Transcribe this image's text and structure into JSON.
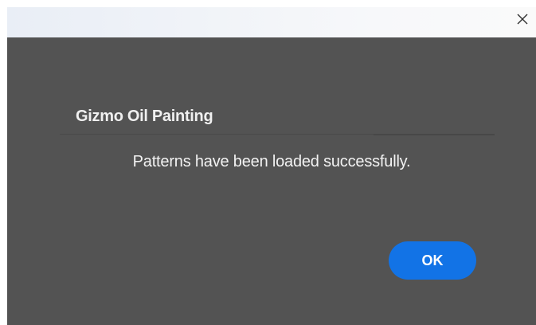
{
  "titlebar": {
    "close_icon": "close-icon"
  },
  "dialog": {
    "plugin_name": "Gizmo Oil Painting",
    "message": "Patterns have been loaded successfully.",
    "ok_label": "OK"
  },
  "colors": {
    "background": "#535353",
    "accent": "#1273e6",
    "text": "#f2f2f2"
  }
}
